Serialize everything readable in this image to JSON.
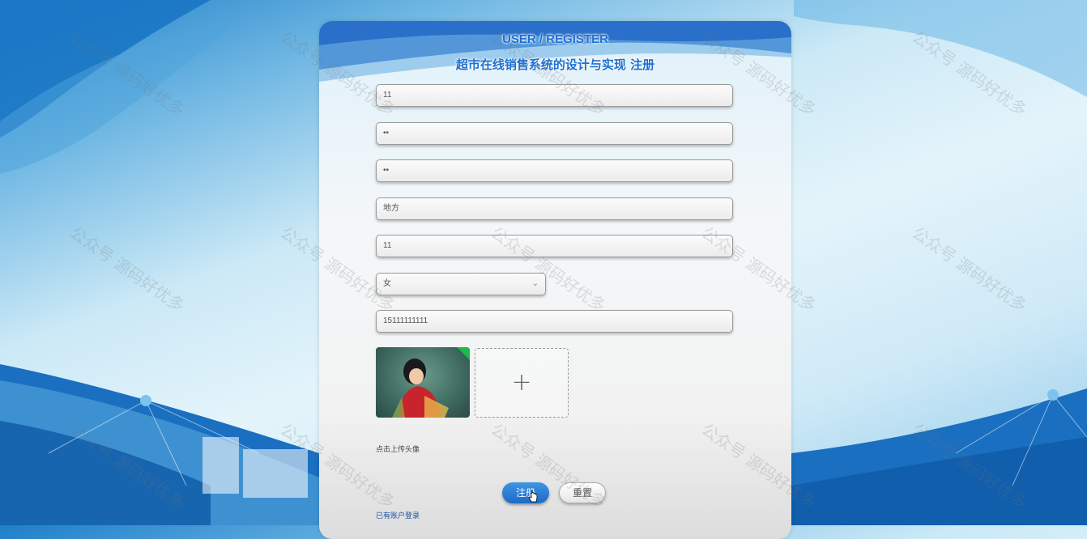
{
  "header": {
    "title_en": "USER / REGISTER",
    "title_cn": "超市在线销售系统的设计与实现 注册"
  },
  "form": {
    "fields": [
      {
        "name": "account",
        "value": "11"
      },
      {
        "name": "password",
        "value": "••"
      },
      {
        "name": "confirm-password",
        "value": "••"
      },
      {
        "name": "address",
        "value": "地方"
      },
      {
        "name": "name",
        "value": "11"
      },
      {
        "name": "phone",
        "value": "15111111111"
      }
    ],
    "gender": {
      "selected": "女"
    },
    "avatar": {
      "hint": "点击上传头像",
      "upload_icon": "plus-icon"
    }
  },
  "buttons": {
    "register": "注册",
    "reset": "重置"
  },
  "links": {
    "login": "已有账户登录"
  },
  "watermark": {
    "text": "公众号 源码好优多"
  },
  "colors": {
    "accent": "#1d6fd1",
    "register_button": "#2a7dd6"
  }
}
